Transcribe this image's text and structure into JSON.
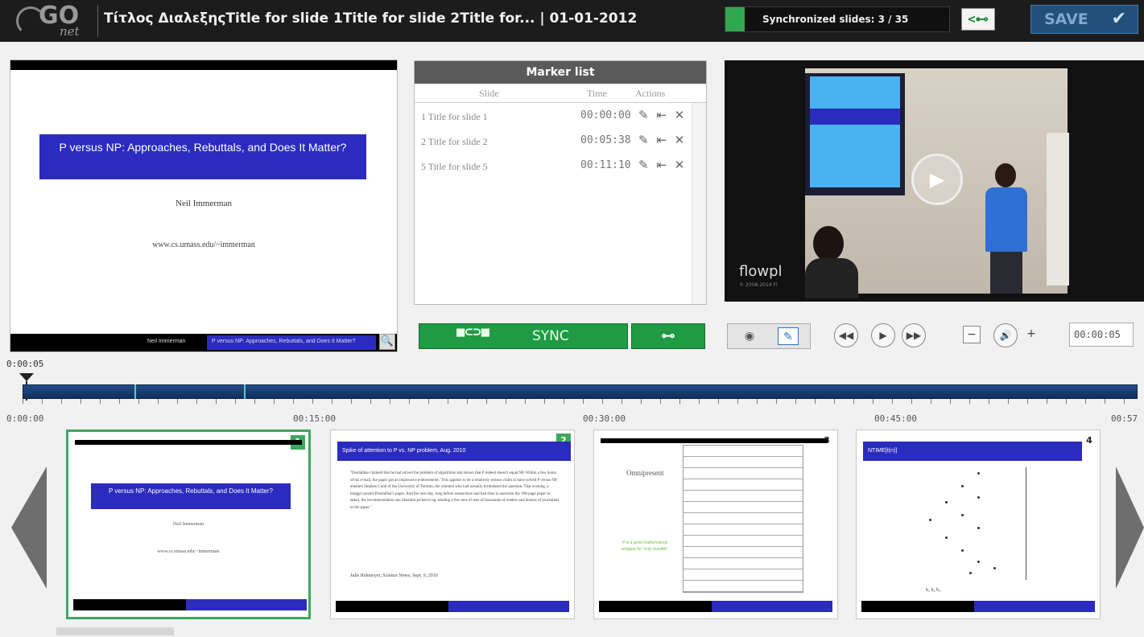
{
  "header": {
    "logo_text": "GO",
    "logo_sub": "net",
    "title": "Τίτλος ΔιαλεξηςTitle for slide 1Title for slide 2Title for... | 01-01-2012",
    "sync_status": "Synchronized slides: 3 / 35",
    "sync_progress": 0.0857,
    "sync_go_icon": "<⊷",
    "save_label": "SAVE",
    "save_icon": "✔"
  },
  "slide_view": {
    "title": "P versus NP: Approaches, Rebuttals, and Does It Matter?",
    "author": "Neil Immerman",
    "url": "www.cs.umass.edu/~immerman",
    "footer_left": "Neil Immerman",
    "footer_right": "P versus NP: Approaches, Rebuttals, and Does It Matter?",
    "zoom_icon": "🔍"
  },
  "marker_list": {
    "title": "Marker list",
    "columns": [
      "Slide",
      "Time",
      "Actions"
    ],
    "rows": [
      {
        "slide": "1 Title for slide 1",
        "time": "00:00:00"
      },
      {
        "slide": "2 Title for slide 2",
        "time": "00:05:38"
      },
      {
        "slide": "5 Title for slide 5",
        "time": "00:11:10"
      }
    ],
    "action_icons": [
      "✎",
      "⇤",
      "✕"
    ]
  },
  "sync": {
    "label": "SYNC",
    "icon": "■⊂⊃■",
    "next_icon": "⊷"
  },
  "video": {
    "brand": "flowpl",
    "brand_sub": "© 2008-2014 Fl",
    "play_icon": "▶"
  },
  "controls": {
    "eye_icon": "◉",
    "edit_icon": "✎",
    "rewind_icon": "◀◀",
    "play_icon": "▶",
    "forward_icon": "▶▶",
    "vol_down_icon": "−",
    "volume_icon": "🔊",
    "vol_up_icon": "+",
    "time": "00:00:05"
  },
  "timeline": {
    "current": "0:00:05",
    "current_fraction": 0.0015,
    "marker_fractions": [
      0.0,
      0.0999,
      0.198
    ],
    "ticks": [
      "0:00:00",
      "00:15:00",
      "00:30:00",
      "00:45:00",
      "00:57"
    ]
  },
  "thumbnails": [
    {
      "number": "1",
      "title": "P versus NP: Approaches, Rebuttals, and Does It Matter?",
      "author": "Neil Immerman",
      "url": "www.cs.umass.edu/~immerman"
    },
    {
      "number": "2",
      "title": "Spike of attention to P vs. NP problem, Aug. 2010",
      "quote": "\"Deolalikar claimed that he had solved the problem of algorithms and shown that P indeed doesn't equal NP. Within a few hours of his e-mail, the paper got an impressive endorsement: 'This appears to be a relatively serious claim to have solved P versus NP,' emailed Stephen Cook of the University of Toronto, the scientist who had actually formulated the question. That evening, a blogger posted Deolalikar's paper. And the next day, long before researchers had had time to ascertain the 100-page paper in detail, the recommendation site Slashdot picked it up, sending a few tens of tens of thousands of readers and dozens of journalists to the paper.\"",
      "cite": "Julie Rehmeyer, Science News, Sept. 9, 2010"
    },
    {
      "number": "3",
      "side": "Omnipresent",
      "green": "P is a good mathematical wrapper for \"truly feasible\""
    },
    {
      "number": "4",
      "title": "NTIME[t(n)]",
      "xlabel": "b₁  b₂  b₃"
    }
  ]
}
